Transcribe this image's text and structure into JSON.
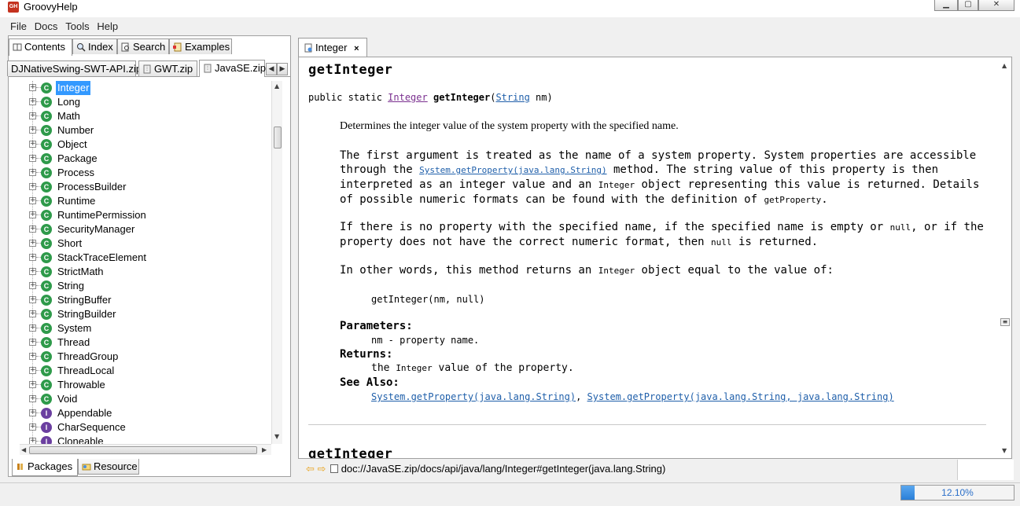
{
  "window": {
    "title": "GroovyHelp",
    "icon_text": "GH"
  },
  "menu": [
    "File",
    "Docs",
    "Tools",
    "Help"
  ],
  "left_tabs": [
    "Contents",
    "Index",
    "Search",
    "Examples"
  ],
  "archive_tabs": [
    "DJNativeSwing-SWT-API.zip",
    "GWT.zip",
    "JavaSE.zip"
  ],
  "tree": {
    "items": [
      {
        "label": "Integer",
        "kind": "C",
        "selected": true
      },
      {
        "label": "Long",
        "kind": "C"
      },
      {
        "label": "Math",
        "kind": "C"
      },
      {
        "label": "Number",
        "kind": "C"
      },
      {
        "label": "Object",
        "kind": "C"
      },
      {
        "label": "Package",
        "kind": "C"
      },
      {
        "label": "Process",
        "kind": "C"
      },
      {
        "label": "ProcessBuilder",
        "kind": "C"
      },
      {
        "label": "Runtime",
        "kind": "C"
      },
      {
        "label": "RuntimePermission",
        "kind": "C"
      },
      {
        "label": "SecurityManager",
        "kind": "C"
      },
      {
        "label": "Short",
        "kind": "C"
      },
      {
        "label": "StackTraceElement",
        "kind": "C"
      },
      {
        "label": "StrictMath",
        "kind": "C"
      },
      {
        "label": "String",
        "kind": "C"
      },
      {
        "label": "StringBuffer",
        "kind": "C"
      },
      {
        "label": "StringBuilder",
        "kind": "C"
      },
      {
        "label": "System",
        "kind": "C"
      },
      {
        "label": "Thread",
        "kind": "C"
      },
      {
        "label": "ThreadGroup",
        "kind": "C"
      },
      {
        "label": "ThreadLocal",
        "kind": "C"
      },
      {
        "label": "Throwable",
        "kind": "C"
      },
      {
        "label": "Void",
        "kind": "C"
      },
      {
        "label": "Appendable",
        "kind": "I"
      },
      {
        "label": "CharSequence",
        "kind": "I"
      },
      {
        "label": "Cloneable",
        "kind": "I"
      }
    ]
  },
  "bottom_tabs": [
    "Packages",
    "Resource"
  ],
  "doc": {
    "tab_label": "Integer",
    "heading": "getInteger",
    "signature": {
      "prefix": "public static ",
      "return_type": "Integer",
      "name": "getInteger",
      "open": "(",
      "param_type": "String",
      "param_rest": " nm)"
    },
    "p1": "Determines the integer value of the system property with the specified name.",
    "p2a": "The first argument is treated as the name of a system property. System properties are accessible through the ",
    "p2_link": "System.getProperty(java.lang.String)",
    "p2b": " method. The string value of this property is then interpreted as an integer value and an ",
    "p2_code1": "Integer",
    "p2c": " object representing this value is returned. Details of possible numeric formats can be found with the definition of ",
    "p2_code2": "getProperty",
    "p2d": ".",
    "p3a": "If there is no property with the specified name, if the specified name is empty or ",
    "p3_code1": "null",
    "p3b": ", or if the property does not have the correct numeric format, then ",
    "p3_code2": "null",
    "p3c": " is returned.",
    "p4a": "In other words, this method returns an ",
    "p4_code": "Integer",
    "p4b": " object equal to the value of:",
    "code_sample": "getInteger(nm, null)",
    "params_label": "Parameters:",
    "param_text": "nm - property name.",
    "returns_label": "Returns:",
    "returns_a": "the ",
    "returns_code": "Integer",
    "returns_b": " value of the property.",
    "see_label": "See Also:",
    "see1": "System.getProperty(java.lang.String)",
    "see_sep": ", ",
    "see2": "System.getProperty(java.lang.String, java.lang.String)",
    "next_heading": "getInteger"
  },
  "url": "doc://JavaSE.zip/docs/api/java/lang/Integer#getInteger(java.lang.String)",
  "status": {
    "progress_text": "12.10%",
    "progress_fraction": 0.121
  }
}
